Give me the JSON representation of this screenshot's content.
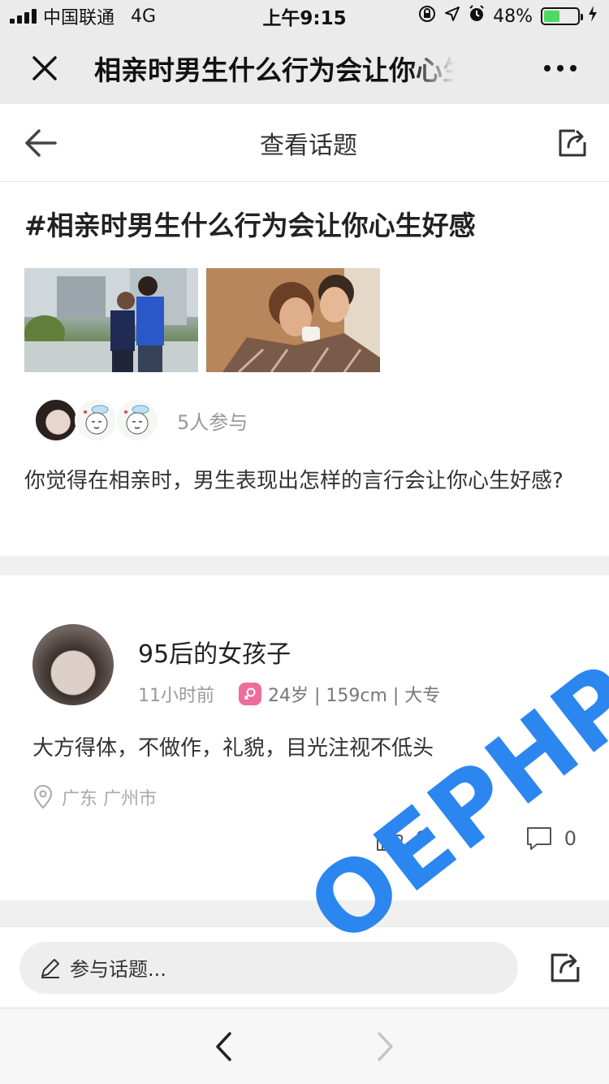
{
  "status_bar": {
    "carrier": "中国联通",
    "network": "4G",
    "time": "上午9:15",
    "battery_percent": "48%",
    "battery_level": 0.48,
    "battery_color": "#4cd964"
  },
  "wechat_header": {
    "title": "相亲时男生什么行为会让你心生好感",
    "close_icon": "close-icon",
    "more_icon": "more-icon"
  },
  "page_nav": {
    "title": "查看话题",
    "back_icon": "arrow-left-icon",
    "share_icon": "share-icon"
  },
  "topic": {
    "title": "#相亲时男生什么行为会让你心生好感",
    "participants_text": "5人参与",
    "description": "你觉得在相亲时，男生表现出怎样的言行会让你心生好感?"
  },
  "answer": {
    "name": "95后的女孩子",
    "time": "11小时前",
    "info": "24岁 | 159cm | 大专",
    "text": "大方得体，不做作，礼貌，目光注视不低头",
    "location": "广东 广州市",
    "like_count": "0",
    "comment_count": "0",
    "gender_color": "#f06c9b"
  },
  "input_bar": {
    "placeholder": "参与话题..."
  },
  "watermark": {
    "text": "OEPHP",
    "color": "#2b86f0"
  }
}
